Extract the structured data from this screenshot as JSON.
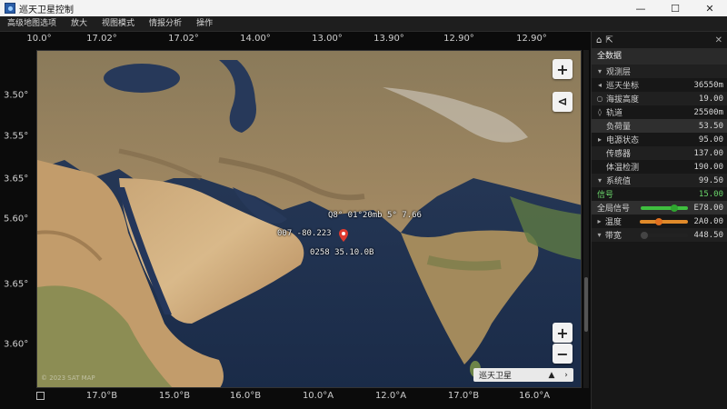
{
  "window": {
    "title": "巡天卫星控制",
    "controls": {
      "minimize": "—",
      "maximize": "☐",
      "close": "✕"
    }
  },
  "menu": [
    "高级地图选项",
    "放大",
    "视图模式",
    "情报分析",
    "操作"
  ],
  "map": {
    "top_ticks": [
      "10.0°",
      "17.02°",
      "17.02°",
      "14.00°",
      "13.00°",
      "13.90°",
      "12.90°",
      "12.90°"
    ],
    "bottom_ticks": [
      "17.0°B",
      "15.0°B",
      "16.0°B",
      "10.0°A",
      "12.0°A",
      "17.0°B",
      "16.0°A"
    ],
    "left_ticks": [
      "3.50°",
      "3.55°",
      "3.65°",
      "5.60°",
      "3.65°",
      "3.60°"
    ],
    "label_top": "Q8° 01°20mb 5° 7.66",
    "label_left": "007 -80.223",
    "label_pin": "0258 35.10.0B",
    "zoom_in": "+",
    "zoom_out": "−",
    "compass": "⊲",
    "add": "+",
    "layer_select": {
      "label": "巡天卫星",
      "arrow_left": "▲",
      "arrow_right": "›"
    },
    "copyright": "© 2023 SAT MAP"
  },
  "panel": {
    "head_icons": [
      "⌂",
      "⇱"
    ],
    "close": "✕",
    "title": "全数据",
    "rows": [
      {
        "icon": "▾",
        "label": "观测层",
        "value": ""
      },
      {
        "icon": "◂",
        "label": "巡天坐标",
        "value": "36550m"
      },
      {
        "icon": "○",
        "label": "海拔高度",
        "value": "19.00"
      },
      {
        "icon": "◊",
        "label": "轨道",
        "value": "25500m"
      },
      {
        "icon": "",
        "label": "负荷量",
        "value": "53.50"
      },
      {
        "icon": "▸",
        "label": "电源状态",
        "value": "95.00"
      },
      {
        "icon": "",
        "label": "传感器",
        "value": "137.00"
      },
      {
        "icon": "",
        "label": "体温检测",
        "value": "190.00"
      },
      {
        "icon": "▾",
        "label": "系统值",
        "value": "99.50"
      }
    ],
    "green_row": {
      "label": "信号",
      "value": "15.00"
    },
    "bars": [
      {
        "label": "全局信号",
        "value": "E78.00",
        "color": "#3fbf3f",
        "thumb": "#2fa52f",
        "pos": 0.7
      },
      {
        "label": "温度",
        "value": "2A0.00",
        "color": "#e08a2a",
        "thumb": "#e07020",
        "pos": 0.4
      },
      {
        "label": "带宽",
        "value": "448.50",
        "color": "#222222",
        "thumb": "#444444",
        "pos": 0.1
      }
    ]
  }
}
